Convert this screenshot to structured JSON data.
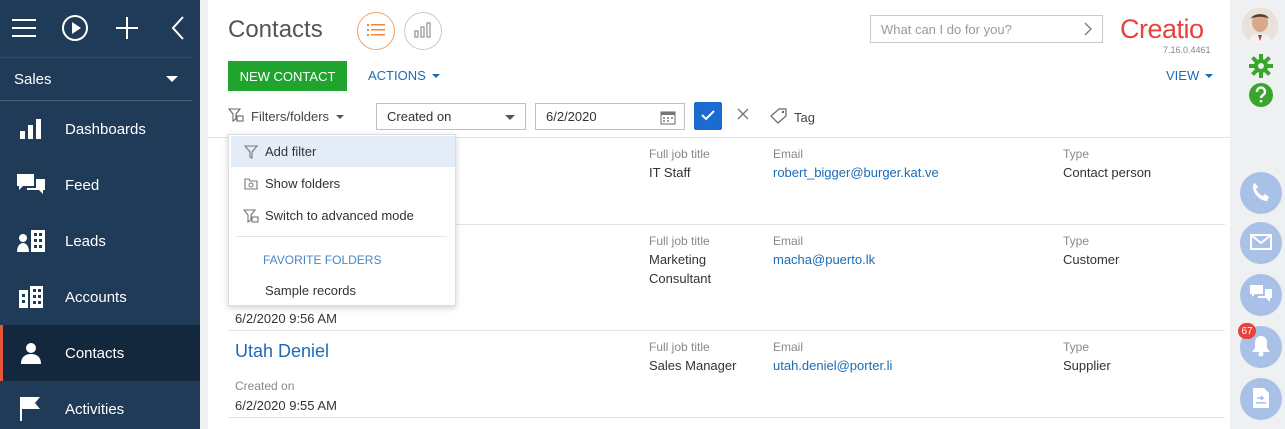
{
  "sidebar": {
    "workplace": "Sales",
    "items": [
      {
        "label": "Dashboards",
        "icon": "dashboards-icon"
      },
      {
        "label": "Feed",
        "icon": "feed-icon"
      },
      {
        "label": "Leads",
        "icon": "leads-icon"
      },
      {
        "label": "Accounts",
        "icon": "accounts-icon"
      },
      {
        "label": "Contacts",
        "icon": "contacts-icon",
        "active": true
      },
      {
        "label": "Activities",
        "icon": "activities-icon"
      }
    ]
  },
  "header": {
    "title": "Contacts",
    "search_placeholder": "What can I do for you?",
    "logo": "Creatio",
    "version": "7.16.0.4461"
  },
  "toolbar": {
    "new_label": "NEW CONTACT",
    "actions_label": "ACTIONS",
    "view_label": "VIEW"
  },
  "filters": {
    "filters_label": "Filters/folders",
    "column_value": "Created on",
    "date_value": "6/2/2020",
    "tag_label": "Tag"
  },
  "dropdown": {
    "items": [
      {
        "label": "Add filter",
        "icon": "filter-icon"
      },
      {
        "label": "Show folders",
        "icon": "folder-search-icon"
      },
      {
        "label": "Switch to advanced mode",
        "icon": "advanced-filter-icon"
      }
    ],
    "favorites_header": "FAVORITE FOLDERS",
    "sample": "Sample records"
  },
  "records": [
    {
      "name": "",
      "job_label": "Full job title",
      "job": "IT Staff",
      "email_label": "Email",
      "email": "robert_bigger@burger.kat.ve",
      "type_label": "Type",
      "type": "Contact person",
      "created_label": "",
      "created": ""
    },
    {
      "name": "",
      "job_label": "Full job title",
      "job": "Marketing Consultant",
      "email_label": "Email",
      "email": "macha@puerto.lk",
      "type_label": "Type",
      "type": "Customer",
      "created_label": "",
      "created": "6/2/2020 9:56 AM"
    },
    {
      "name": "Utah Deniel",
      "job_label": "Full job title",
      "job": "Sales Manager",
      "email_label": "Email",
      "email": "utah.deniel@porter.li",
      "type_label": "Type",
      "type": "Supplier",
      "created_label": "Created on",
      "created": "6/2/2020 9:55 AM"
    }
  ],
  "rightbar": {
    "notification_count": "67",
    "accent": "#a9c1e6",
    "gear_color": "#3aa52e"
  },
  "colors": {
    "sidebar_bg": "#1f3b57",
    "active_marker": "#e8543c",
    "primary_green": "#1fa52e",
    "link_blue": "#1b6bb8",
    "logo_red": "#e5433c"
  }
}
